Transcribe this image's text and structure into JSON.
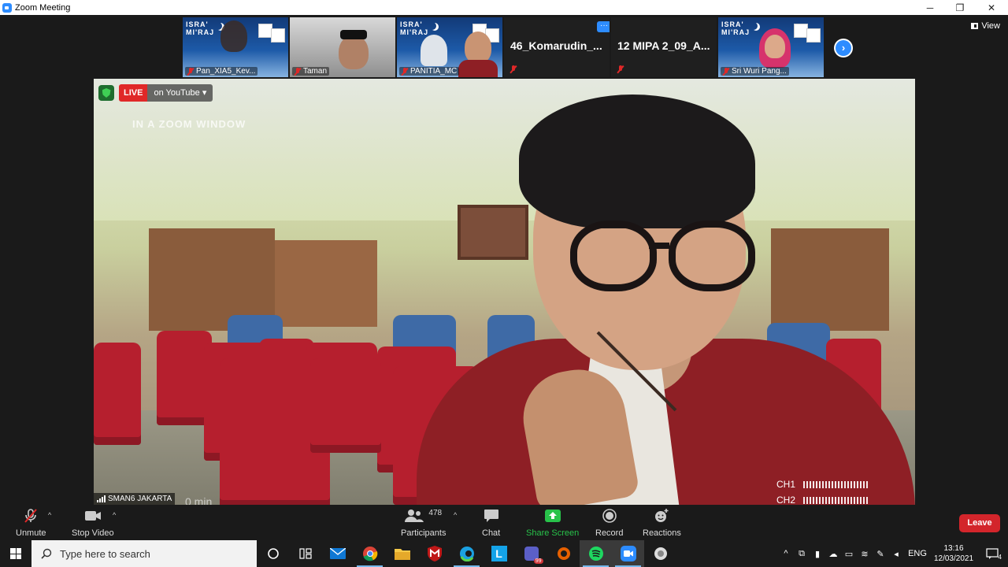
{
  "window": {
    "title": "Zoom Meeting",
    "minimize": "─",
    "restore": "❐",
    "close": "✕"
  },
  "strip": {
    "thumbs": [
      {
        "name": "Pan_XIA5_Kev...",
        "poster": true
      },
      {
        "name": "Taman",
        "poster": false
      },
      {
        "name": "PANITIA_MC",
        "poster": true
      },
      {
        "name": "46_Komarudin_...",
        "textonly": true
      },
      {
        "name": "12 MIPA 2_09_A...",
        "textonly": true
      },
      {
        "name": "Sri Wuri Pang...",
        "poster": true
      }
    ],
    "poster_title_1": "ISRA'",
    "poster_title_2": "MI'RAJ",
    "dots_label": "···",
    "next_label": "›"
  },
  "view_label": "View",
  "video": {
    "live_badge": "LIVE",
    "live_target": "on YouTube",
    "overlay_text": "IN A ZOOM WINDOW",
    "ch1_label": "CH1",
    "ch2_label": "CH2",
    "name_tag": "SMAN6 JAKARTA",
    "watermark_fragment": "0 min"
  },
  "toolbar": {
    "unmute": "Unmute",
    "stop_video": "Stop Video",
    "participants": "Participants",
    "participants_count": "478",
    "chat": "Chat",
    "share_screen": "Share Screen",
    "record": "Record",
    "reactions": "Reactions",
    "leave": "Leave",
    "caret": "^"
  },
  "taskbar": {
    "search_placeholder": "Type here to search",
    "lang": "ENG",
    "time": "13:16",
    "date": "12/03/2021",
    "notif_count": "4",
    "teams_badge": "99"
  },
  "colors": {
    "accent": "#2d8cff",
    "leave": "#d3252b",
    "live": "#e02828",
    "share": "#28c24a"
  }
}
